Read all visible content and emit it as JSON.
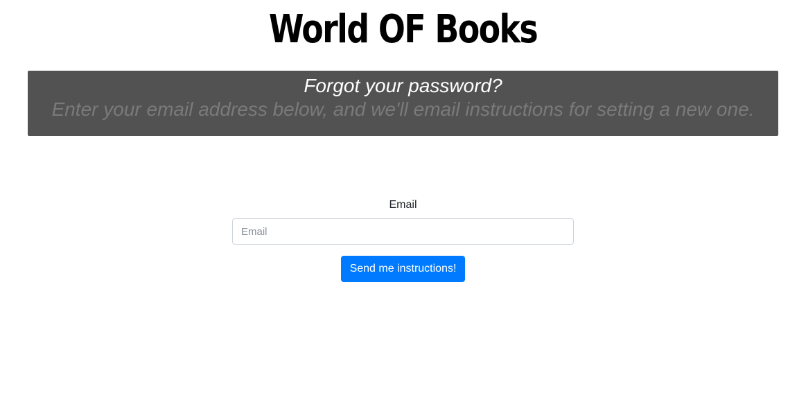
{
  "site": {
    "title": "World OF Books"
  },
  "banner": {
    "heading": "Forgot your password?",
    "subtext": "Enter your email address below, and we'll email instructions for setting a new one."
  },
  "form": {
    "email_label": "Email",
    "email_placeholder": "Email",
    "email_value": "",
    "submit_label": "Send me instructions!"
  },
  "colors": {
    "banner_background": "#525252",
    "banner_heading": "#ffffff",
    "banner_subtext": "#7a7a7a",
    "primary_button": "#007bff"
  }
}
